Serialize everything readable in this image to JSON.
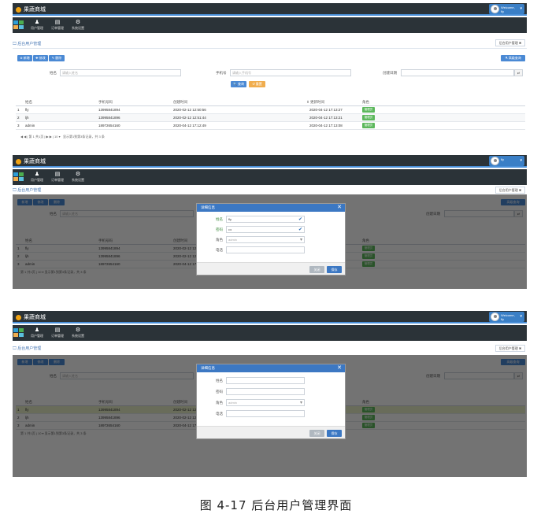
{
  "app": {
    "title": "果蔬商城",
    "user_top": "Welcome,",
    "user_name": "fly"
  },
  "nav": [
    {
      "label": "用户管理",
      "icon": "user-icon"
    },
    {
      "label": "订单管理",
      "icon": "list-icon"
    },
    {
      "label": "系统设置",
      "icon": "cogs-icon"
    }
  ],
  "breadcrumb": "后台用户管理",
  "tab": {
    "label": "后台用户管理",
    "close": "✖"
  },
  "toolbar": {
    "add": "新增",
    "edit": "修改",
    "delete": "删除",
    "advanced": "高级查询"
  },
  "search": {
    "name_label": "姓名",
    "name_placeholder": "请输入姓名",
    "phone_label": "手机号",
    "phone_placeholder": "请输入手机号",
    "date_label": "创建日期",
    "query": "查询",
    "reset": "重置"
  },
  "table": {
    "headers": [
      "姓名",
      "手机号码",
      "创建时间",
      "更新时间",
      "角色"
    ],
    "rows": [
      {
        "no": "1",
        "name": "fly",
        "phone": "13995841894",
        "created": "2020-02-12 12:50:56",
        "updated": "2020-04-12 17:13:27",
        "role": "管理员"
      },
      {
        "no": "2",
        "name": "ljh",
        "phone": "13995841896",
        "created": "2020-02-12 12:51:44",
        "updated": "2020-04-12 17:13:21",
        "role": "管理员"
      },
      {
        "no": "3",
        "name": "admin",
        "phone": "18972654160",
        "created": "2020-04-12 17:12:49",
        "updated": "2020-04-12 17:13:08",
        "role": "管理员"
      }
    ]
  },
  "pager": {
    "page_label": "第",
    "page": "1",
    "total_pages": "共1页",
    "size": "10",
    "info": "显示第1到第3条记录，共 3 条"
  },
  "dialog": {
    "title": "详细信息",
    "name_label": "姓名",
    "pwd_label": "密码",
    "role_label": "角色",
    "phone_label": "电话",
    "name_value": "fly",
    "pwd_value": "•••",
    "role_value": "admin",
    "cancel": "关闭",
    "save": "保存"
  },
  "caption": "图 4-17  后台用户管理界面"
}
